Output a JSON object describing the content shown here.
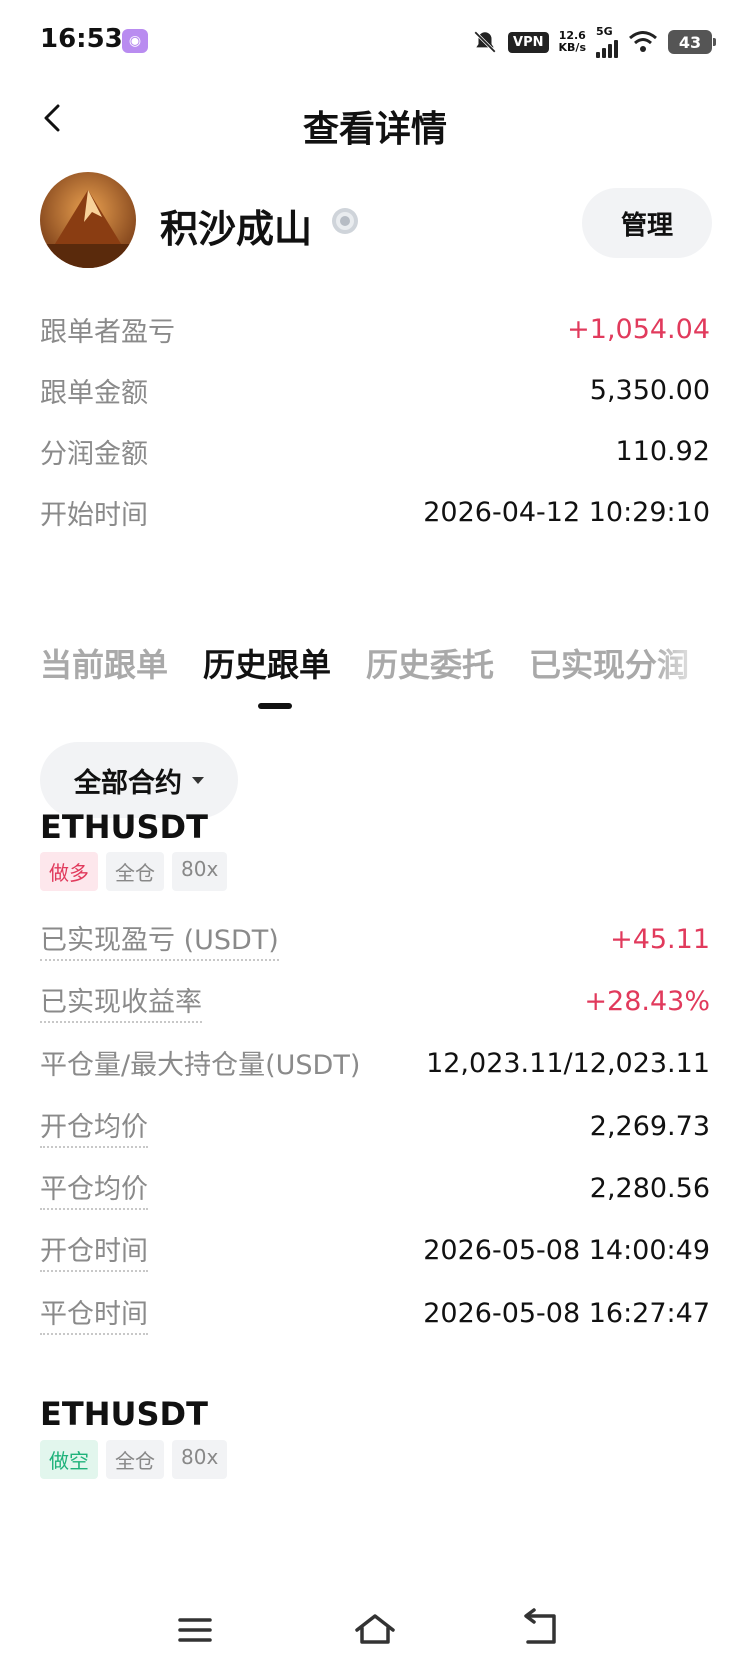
{
  "status_bar": {
    "time": "16:53",
    "app_icon": "app-notification-icon",
    "vpn": "VPN",
    "speed_top": "12.6",
    "speed_bottom": "KB/s",
    "network": "5G",
    "battery": "43"
  },
  "header": {
    "title": "查看详情"
  },
  "profile": {
    "name": "积沙成山",
    "manage_label": "管理"
  },
  "summary": [
    {
      "label": "跟单者盈亏",
      "value": "+1,054.04",
      "highlight": true
    },
    {
      "label": "跟单金额",
      "value": "5,350.00",
      "highlight": false
    },
    {
      "label": "分润金额",
      "value": "110.92",
      "highlight": false
    },
    {
      "label": "开始时间",
      "value": "2026-04-12 10:29:10",
      "highlight": false
    }
  ],
  "tabs": [
    {
      "label": "当前跟单",
      "active": false
    },
    {
      "label": "历史跟单",
      "active": true
    },
    {
      "label": "历史委托",
      "active": false
    },
    {
      "label": "已实现分润",
      "active": false
    }
  ],
  "filter": {
    "label": "全部合约"
  },
  "orders": [
    {
      "symbol": "ETHUSDT",
      "side": "做多",
      "margin": "全仓",
      "leverage": "80x",
      "details": [
        {
          "label": "已实现盈亏 (USDT)",
          "value": "+45.11"
        },
        {
          "label": "已实现收益率",
          "value": "+28.43%"
        },
        {
          "label": "平仓量/最大持仓量(USDT)",
          "value": "12,023.11/12,023.11"
        },
        {
          "label": "开仓均价",
          "value": "2,269.73"
        },
        {
          "label": "平仓均价",
          "value": "2,280.56"
        },
        {
          "label": "开仓时间",
          "value": "2026-05-08 14:00:49"
        },
        {
          "label": "平仓时间",
          "value": "2026-05-08 16:27:47"
        }
      ]
    },
    {
      "symbol": "ETHUSDT",
      "side": "做空",
      "margin": "全仓",
      "leverage": "80x"
    }
  ],
  "colors": {
    "profit": "#e13a5c",
    "short": "#1fb27a",
    "muted": "#8a8a8a"
  }
}
